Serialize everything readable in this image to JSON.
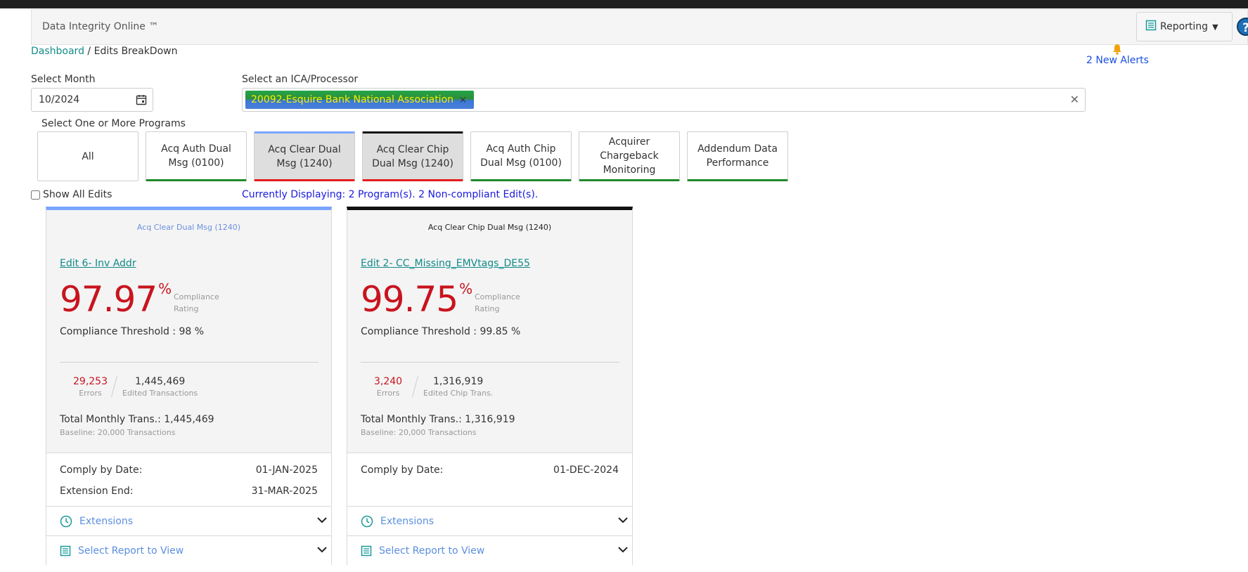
{
  "header": {
    "app_title": "Data Integrity Online ™",
    "reporting_label": "Reporting",
    "help_label": "?"
  },
  "breadcrumb": {
    "dashboard": "Dashboard",
    "separator": " / ",
    "current": "Edits BreakDown"
  },
  "alerts": {
    "label": "2 New Alerts"
  },
  "filters": {
    "month_label": "Select Month",
    "month_value": "10/2024",
    "processor_label": "Select an ICA/Processor",
    "processor_chip": "20092-Esquire Bank National Association",
    "programs_label": "Select One or More Programs"
  },
  "programs": [
    {
      "label": "All"
    },
    {
      "label": "Acq Auth Dual Msg (0100)"
    },
    {
      "label": "Acq Clear Dual Msg (1240)"
    },
    {
      "label": "Acq Clear Chip Dual Msg (1240)"
    },
    {
      "label": "Acq Auth Chip Dual Msg (0100)"
    },
    {
      "label": "Acquirer Chargeback Monitoring"
    },
    {
      "label": "Addendum Data Performance"
    }
  ],
  "show_all_edits": "Show All Edits",
  "displaying": "Currently Displaying: 2 Program(s). 2 Non-compliant Edit(s).",
  "cards": [
    {
      "program": "Acq Clear Dual Msg (1240)",
      "edit_link": "Edit 6- Inv Addr",
      "compliance_value": "97.97",
      "percent_symbol": "%",
      "compliance_label_1": "Compliance",
      "compliance_label_2": "Rating",
      "threshold": "Compliance Threshold :  98 %",
      "errors_value": "29,253",
      "errors_label": "Errors",
      "transactions_value": "1,445,469",
      "transactions_label": "Edited Transactions",
      "total_monthly": "Total Monthly Trans.:  1,445,469",
      "baseline": "Baseline: 20,000 Transactions",
      "comply_by_label": "Comply by Date:",
      "comply_by_value": "01-JAN-2025",
      "extension_end_label": "Extension End:",
      "extension_end_value": "31-MAR-2025",
      "extensions_label": "Extensions",
      "report_label": "Select Report to View"
    },
    {
      "program": "Acq Clear Chip Dual Msg (1240)",
      "edit_link": "Edit 2- CC_Missing_EMVtags_DE55",
      "compliance_value": "99.75",
      "percent_symbol": "%",
      "compliance_label_1": "Compliance",
      "compliance_label_2": "Rating",
      "threshold": "Compliance Threshold :  99.85 %",
      "errors_value": "3,240",
      "errors_label": "Errors",
      "transactions_value": "1,316,919",
      "transactions_label": "Edited Chip Trans.",
      "total_monthly": "Total Monthly Trans.:  1,316,919",
      "baseline": "Baseline: 20,000 Transactions",
      "comply_by_label": "Comply by Date:",
      "comply_by_value": "01-DEC-2024",
      "extensions_label": "Extensions",
      "report_label": "Select Report to View"
    }
  ],
  "colors": {
    "accent_teal": "#128a8a",
    "compliance_red": "#c8141e",
    "link_blue": "#1a1ae0",
    "program_ok_green": "#1f8a2a",
    "program_fail_red": "#e21d1d"
  }
}
